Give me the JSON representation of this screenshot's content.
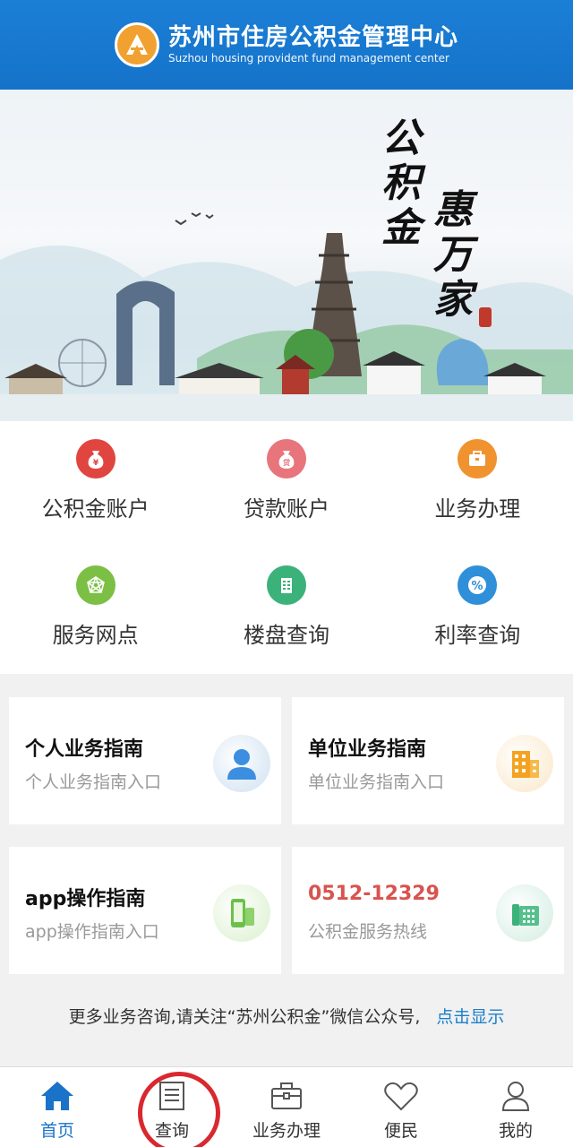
{
  "header": {
    "title": "苏州市住房公积金管理中心",
    "subtitle": "Suzhou housing provident fund management center",
    "logo_icon": "provident-fund-logo"
  },
  "banner": {
    "calligraphy_line1": "公积金",
    "calligraphy_line2": "惠万家"
  },
  "grid": [
    {
      "label": "公积金账户",
      "icon": "money-bag-icon",
      "glyph": "¥",
      "color": "#e0453f"
    },
    {
      "label": "贷款账户",
      "icon": "loan-bag-icon",
      "glyph": "贷",
      "color": "#e8757c"
    },
    {
      "label": "业务办理",
      "icon": "briefcase-icon",
      "glyph": "▣",
      "color": "#f0922e"
    },
    {
      "label": "服务网点",
      "icon": "network-icon",
      "glyph": "✦",
      "color": "#7bbf44"
    },
    {
      "label": "楼盘查询",
      "icon": "building-icon",
      "glyph": "▦",
      "color": "#3bb27a"
    },
    {
      "label": "利率查询",
      "icon": "percent-icon",
      "glyph": "%",
      "color": "#2f8fd8"
    }
  ],
  "cards": [
    {
      "title": "个人业务指南",
      "sub": "个人业务指南入口",
      "icon": "person-icon"
    },
    {
      "title": "单位业务指南",
      "sub": "单位业务指南入口",
      "icon": "office-building-icon"
    },
    {
      "title": "app操作指南",
      "sub": "app操作指南入口",
      "icon": "mobile-phone-icon"
    },
    {
      "title": "0512-12329",
      "sub": "公积金服务热线",
      "icon": "telephone-icon"
    }
  ],
  "more": {
    "text": "更多业务咨询,请关注“苏州公积金”微信公众号,",
    "link": "点击显示"
  },
  "nav": [
    {
      "label": "首页",
      "icon": "home-icon",
      "active": true
    },
    {
      "label": "查询",
      "icon": "document-icon",
      "active": false
    },
    {
      "label": "业务办理",
      "icon": "briefcase-icon",
      "active": false
    },
    {
      "label": "便民",
      "icon": "heart-icon",
      "active": false
    },
    {
      "label": "我的",
      "icon": "user-icon",
      "active": false
    }
  ],
  "colors": {
    "brand_blue": "#1572c9",
    "hotline_red": "#d9534f",
    "annotation_red": "#d9282f"
  }
}
